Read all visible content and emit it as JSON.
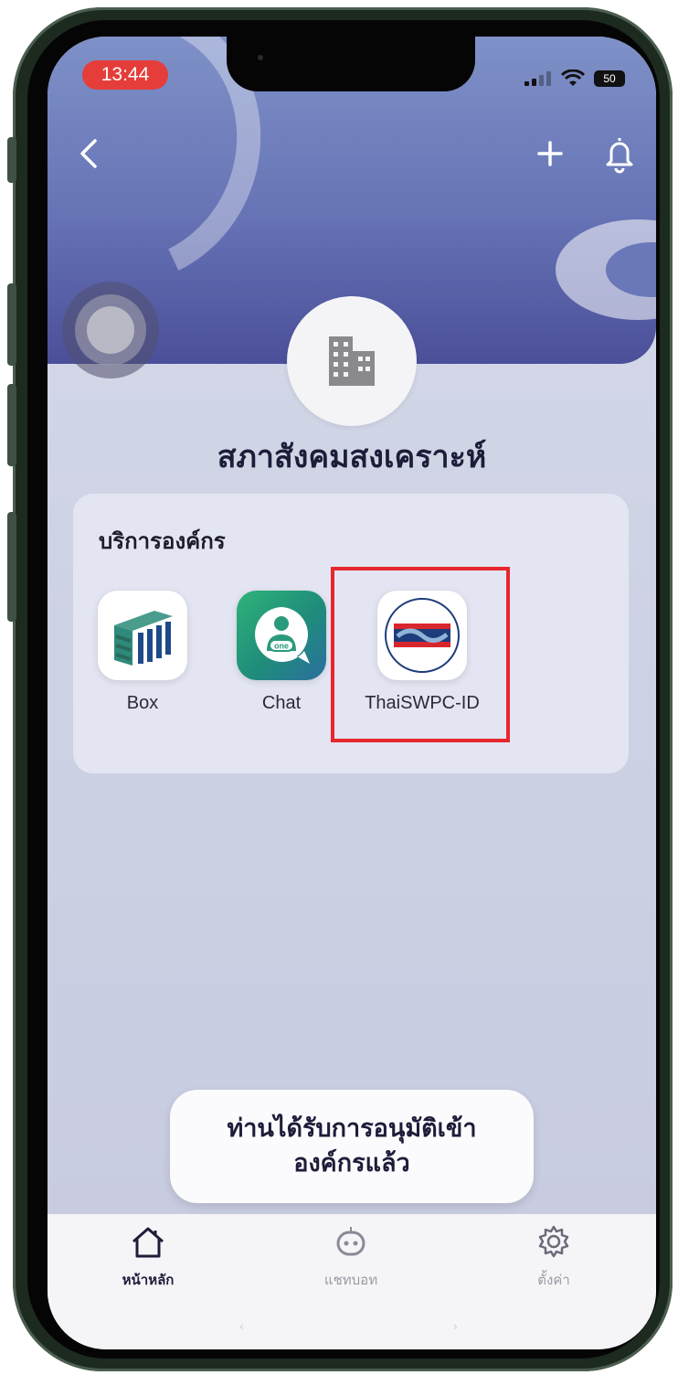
{
  "status_bar": {
    "time": "13:44",
    "battery": "50"
  },
  "header": {
    "back_icon": "chevron-left-icon",
    "add_icon": "plus-icon",
    "notification_icon": "bell-icon"
  },
  "organization": {
    "name": "สภาสังคมสงเคราะห์",
    "avatar_icon": "building-icon"
  },
  "services": {
    "title": "บริการองค์กร",
    "apps": [
      {
        "label": "Box",
        "icon": "box-app-icon"
      },
      {
        "label": "Chat",
        "icon": "chat-app-icon",
        "badge_text": "one"
      },
      {
        "label": "ThaiSWPC-ID",
        "icon": "thaiswpc-logo-icon"
      }
    ]
  },
  "toast": {
    "line1": "ท่านได้รับการอนุมัติเข้า",
    "line2": "องค์กรแล้ว"
  },
  "tabbar": {
    "tabs": [
      {
        "label": "หน้าหลัก",
        "icon": "home-icon",
        "active": true
      },
      {
        "label": "แชทบอท",
        "icon": "chatbot-icon",
        "active": false
      },
      {
        "label": "ตั้งค่า",
        "icon": "gear-icon",
        "active": false
      }
    ]
  },
  "home_indicator": {
    "left": "‹",
    "right": "›"
  },
  "colors": {
    "highlight": "#e8262d",
    "header_top": "#7f91c8",
    "header_bottom": "#4b4f99",
    "time_pill": "#e53e3a"
  }
}
